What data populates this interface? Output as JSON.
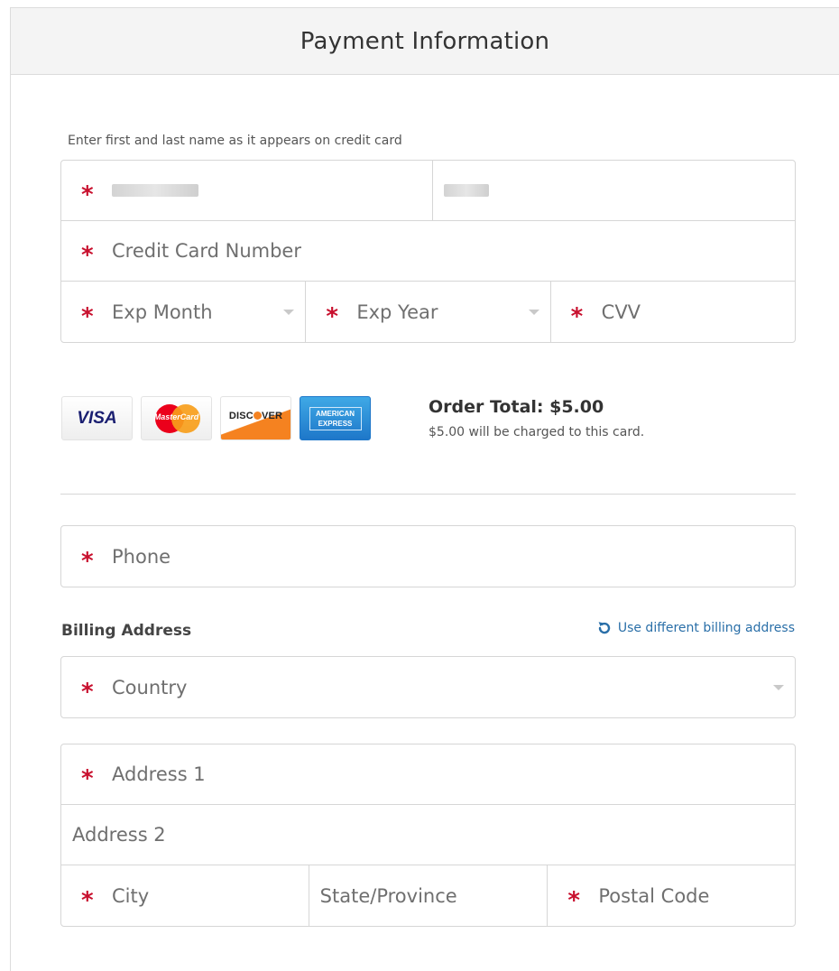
{
  "header": {
    "title": "Payment Information"
  },
  "card_form": {
    "hint": "Enter first and last name as it appears on credit card",
    "card_number_placeholder": "Credit Card Number",
    "exp_month_placeholder": "Exp Month",
    "exp_year_placeholder": "Exp Year",
    "cvv_placeholder": "CVV"
  },
  "card_logos": [
    "visa-logo",
    "mastercard-logo",
    "discover-logo",
    "american-express-logo"
  ],
  "logo_text": {
    "visa": "VISA",
    "mastercard": "MasterCard",
    "discover_a": "DISC",
    "discover_b": "VER",
    "amex_a": "AMERICAN",
    "amex_b": "EXPRESS"
  },
  "order": {
    "total_label": "Order Total: $5.00",
    "charge_note": "$5.00 will be charged to this card."
  },
  "phone": {
    "placeholder": "Phone"
  },
  "billing": {
    "label": "Billing Address",
    "link_label": "Use different billing address",
    "country_placeholder": "Country",
    "address1_placeholder": "Address 1",
    "address2_placeholder": "Address 2",
    "city_placeholder": "City",
    "state_placeholder": "State/Province",
    "postal_placeholder": "Postal Code"
  },
  "colors": {
    "required": "#c8102e",
    "link": "#2a6fa8",
    "border": "#d6d6d6"
  }
}
